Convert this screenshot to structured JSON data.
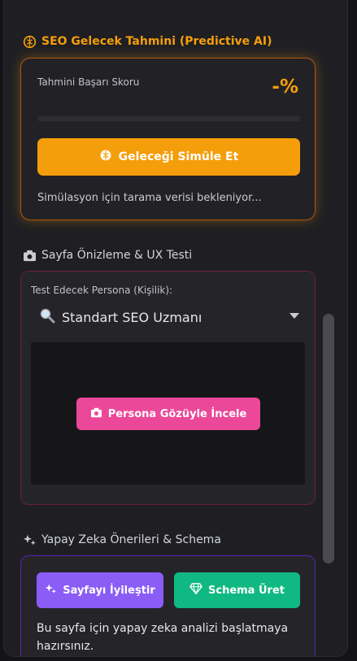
{
  "predictive": {
    "title": "SEO Gelecek Tahmini (Predictive AI)",
    "score_label": "Tahmini Başarı Skoru",
    "score_value": "-%",
    "progress": 0,
    "simulate_button": "Geleceği Simüle Et",
    "status": "Simülasyon için tarama verisi bekleniyor...",
    "icon": "brain-icon",
    "accent": "#f59e0b"
  },
  "preview": {
    "title": "Sayfa Önizleme & UX Testi",
    "icon": "camera-icon",
    "persona_label": "Test Edecek Persona (Kişilik):",
    "persona_selected": "Standart SEO Uzmanı",
    "persona_icon": "magnifier-icon",
    "inspect_button": "Persona Gözüyle İncele",
    "accent": "#ec4899"
  },
  "ai": {
    "title": "Yapay Zeka Önerileri & Schema",
    "icon": "sparkles-icon",
    "improve_button": "Sayfayı İyileştir",
    "schema_button": "Schema Üret",
    "message": "Bu sayfa için yapay zeka analizi başlatmaya hazırsınız.",
    "improve_color": "#8b5cf6",
    "schema_color": "#10b981"
  }
}
